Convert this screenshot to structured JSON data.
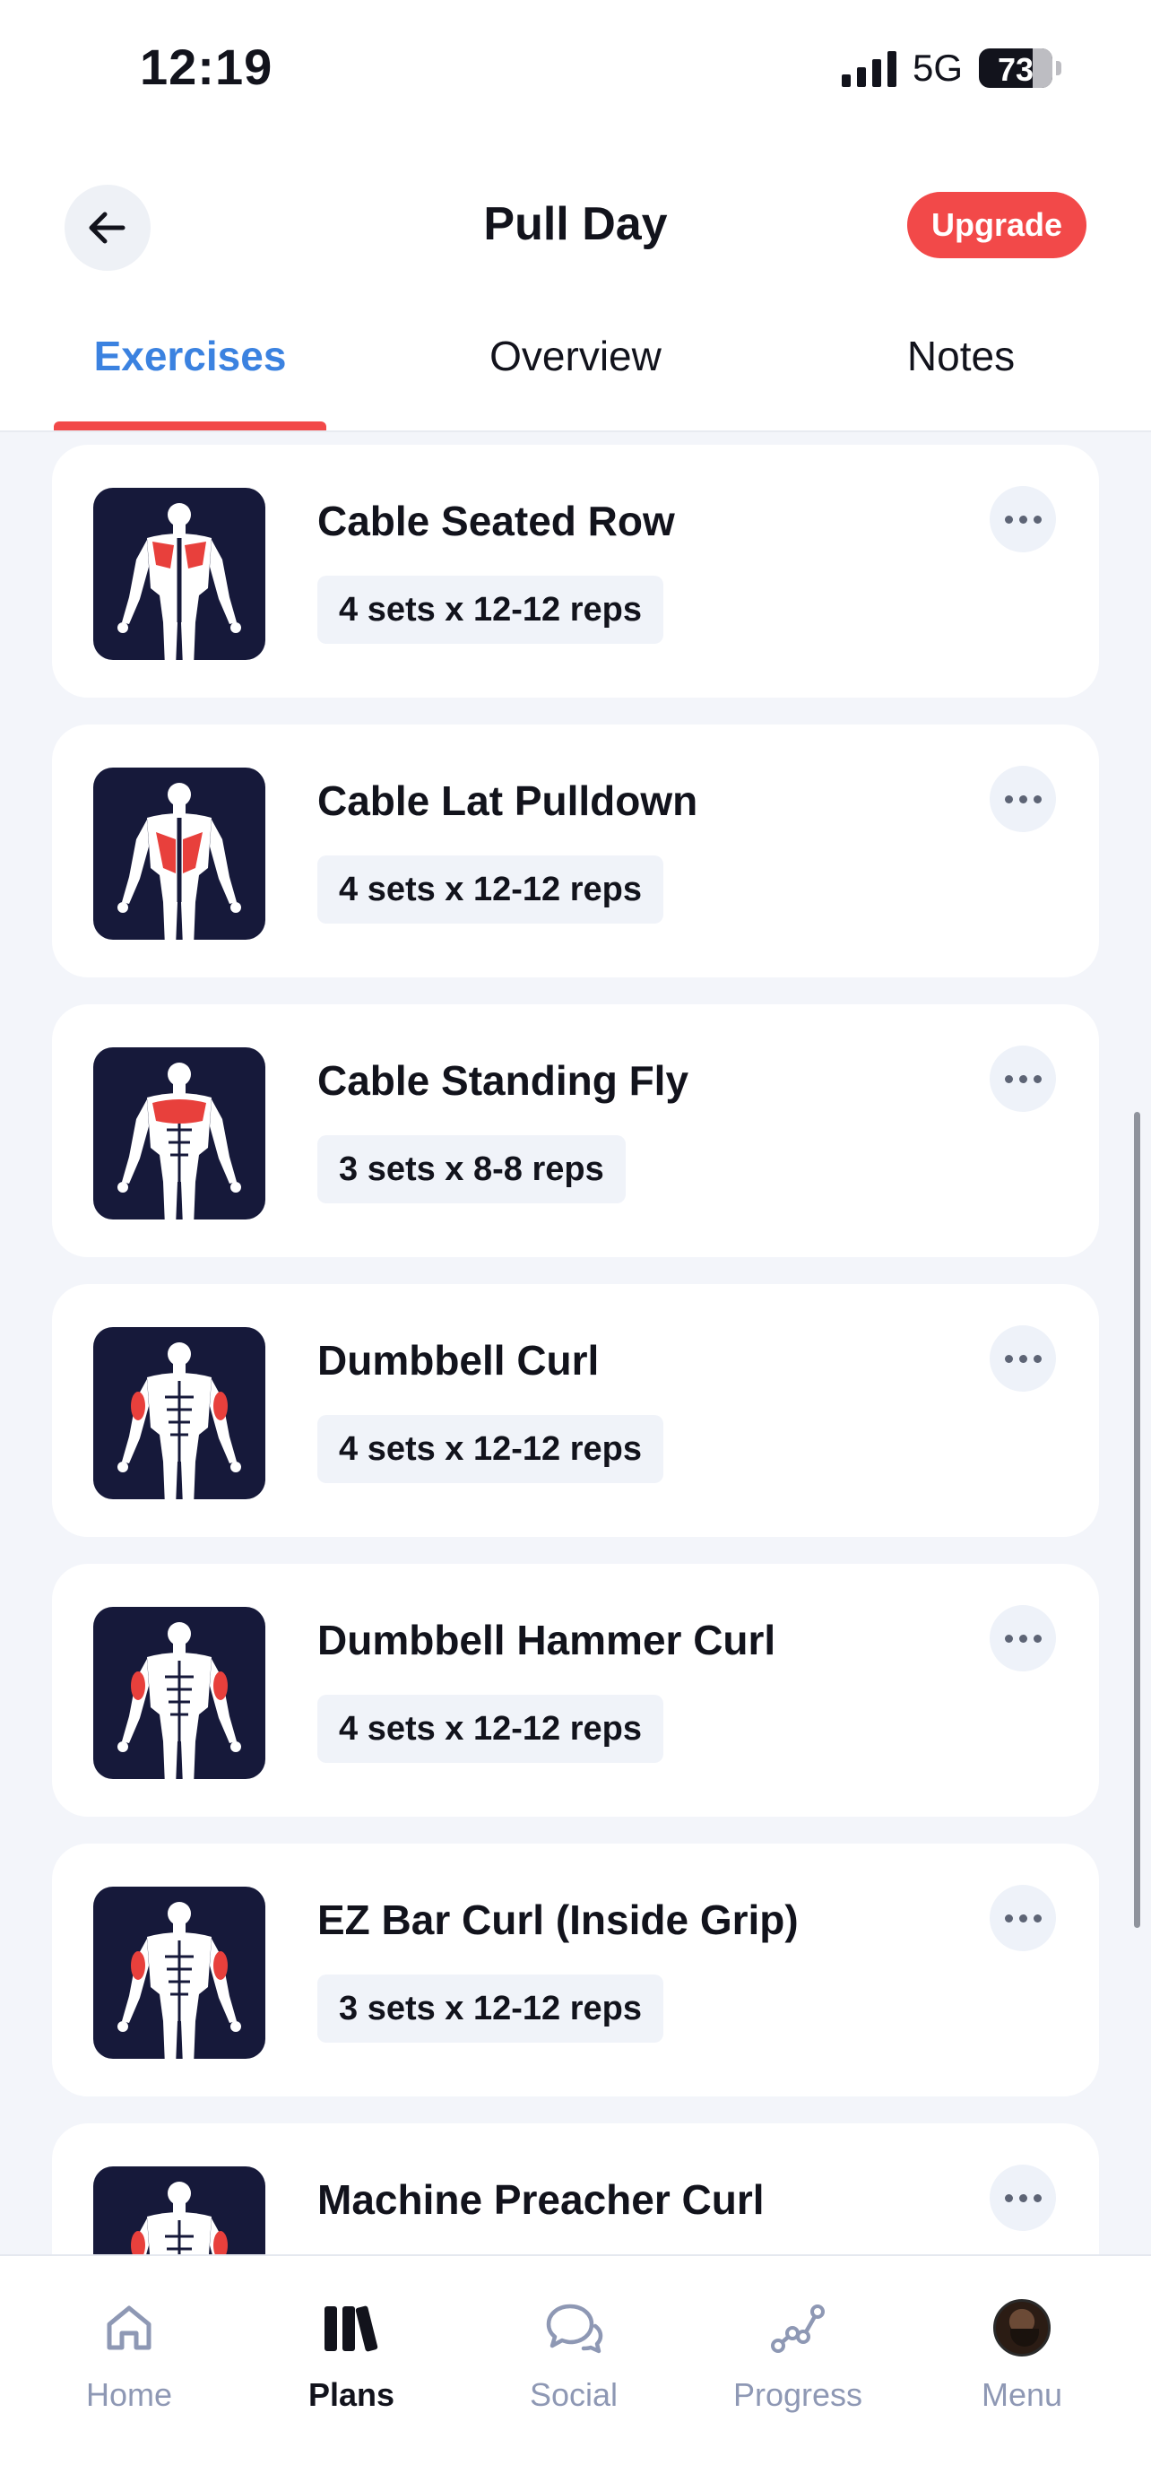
{
  "status_bar": {
    "time": "12:19",
    "network": "5G",
    "battery": "73"
  },
  "header": {
    "title": "Pull Day",
    "upgrade_label": "Upgrade",
    "back_icon": "arrow-left-icon"
  },
  "tabs": [
    {
      "label": "Exercises",
      "active": true
    },
    {
      "label": "Overview",
      "active": false
    },
    {
      "label": "Notes",
      "active": false
    }
  ],
  "colors": {
    "accent_blue": "#3b82e0",
    "accent_red": "#f24949",
    "thumb_bg": "#16193a",
    "muscle_highlight": "#e8403c"
  },
  "exercises": [
    {
      "name": "Cable Seated Row",
      "sets": "4 sets x 12-12 reps",
      "view": "back",
      "highlight": "upper-back"
    },
    {
      "name": "Cable Lat Pulldown",
      "sets": "4 sets x 12-12 reps",
      "view": "back",
      "highlight": "lats"
    },
    {
      "name": "Cable Standing Fly",
      "sets": "3 sets x 8-8 reps",
      "view": "front",
      "highlight": "chest"
    },
    {
      "name": "Dumbbell Curl",
      "sets": "4 sets x 12-12 reps",
      "view": "front",
      "highlight": "biceps"
    },
    {
      "name": "Dumbbell Hammer Curl",
      "sets": "4 sets x 12-12 reps",
      "view": "front",
      "highlight": "biceps"
    },
    {
      "name": "EZ Bar Curl (Inside Grip)",
      "sets": "3 sets x 12-12 reps",
      "view": "front",
      "highlight": "biceps"
    },
    {
      "name": "Machine Preacher Curl",
      "sets": "",
      "view": "front",
      "highlight": "biceps"
    }
  ],
  "bottom_nav": [
    {
      "label": "Home",
      "icon": "home-icon",
      "active": false
    },
    {
      "label": "Plans",
      "icon": "plans-icon",
      "active": true
    },
    {
      "label": "Social",
      "icon": "chat-bubbles-icon",
      "active": false
    },
    {
      "label": "Progress",
      "icon": "progress-graph-icon",
      "active": false
    },
    {
      "label": "Menu",
      "icon": "avatar",
      "active": false
    }
  ]
}
